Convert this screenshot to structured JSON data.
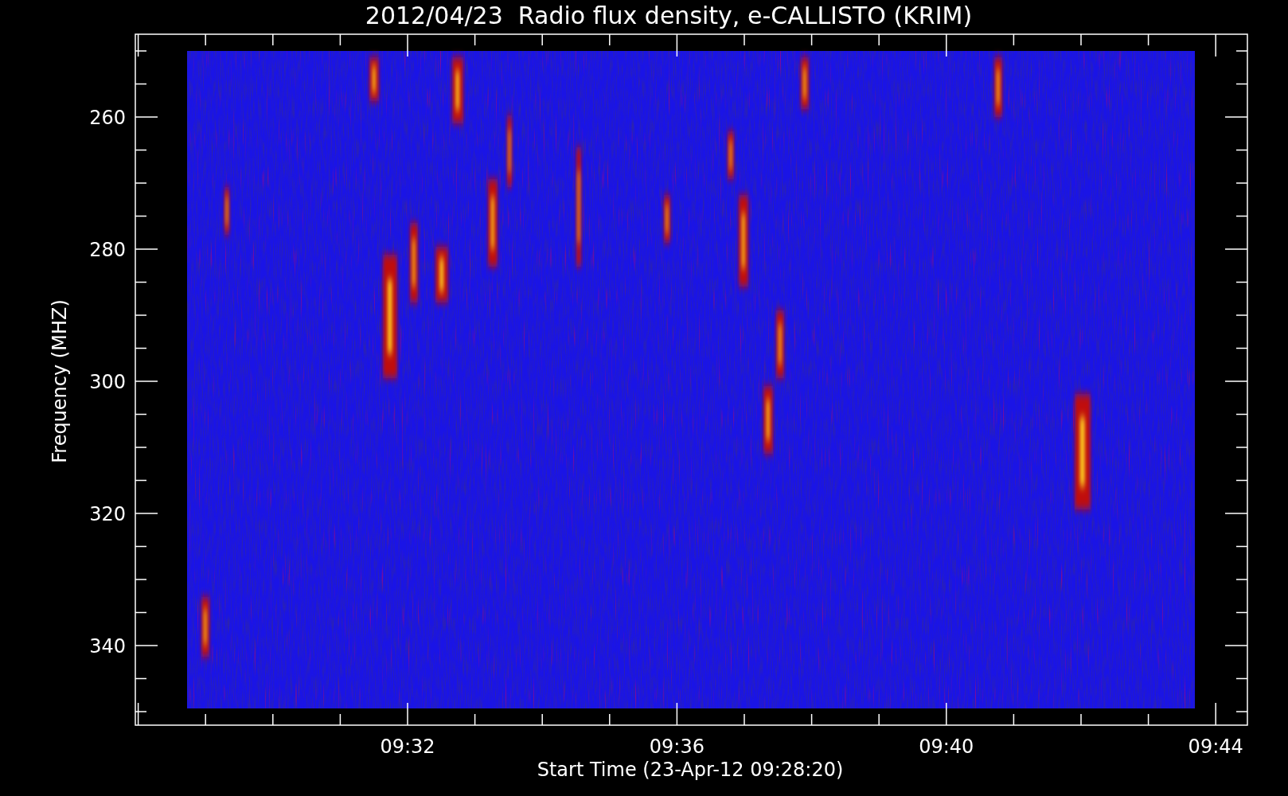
{
  "title": "2012/04/23  Radio flux density, e-CALLISTO (KRIM)",
  "y_axis": {
    "label": "Frequency (MHZ)",
    "ticks": [
      "260",
      "280",
      "300",
      "320",
      "340"
    ]
  },
  "x_axis": {
    "label": "Start Time (23-Apr-12 09:28:20)",
    "ticks": [
      "09:32",
      "09:36",
      "09:40",
      "09:44"
    ]
  }
}
